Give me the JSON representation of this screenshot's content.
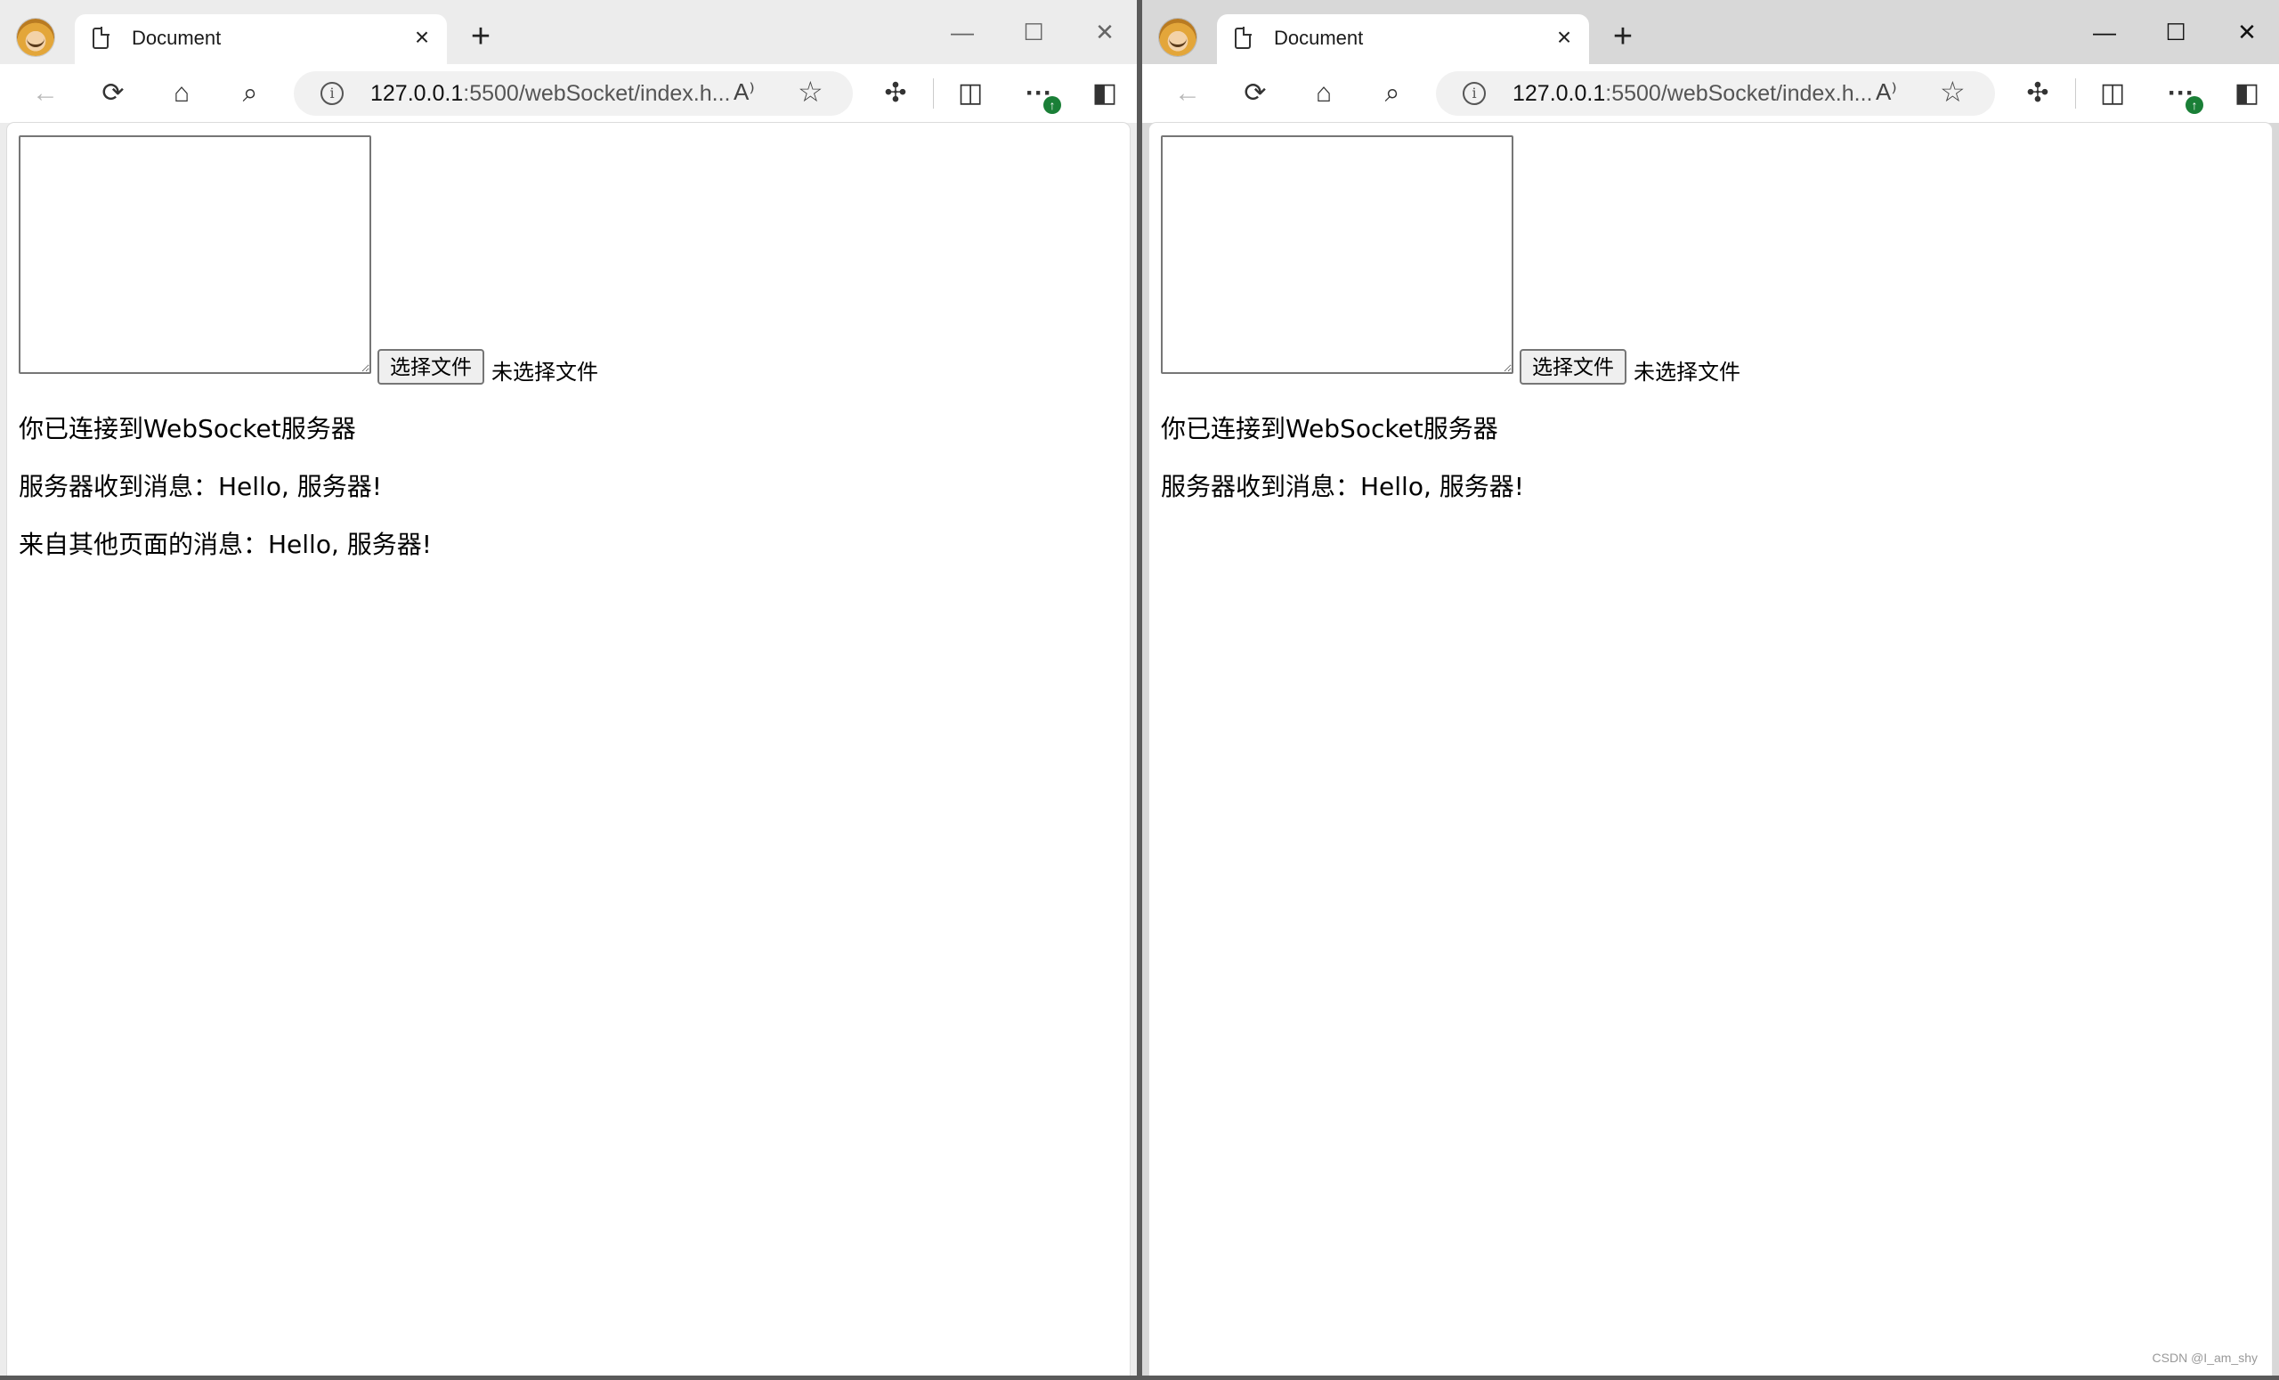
{
  "windows": [
    {
      "tab_title": "Document",
      "tab_close": "×",
      "new_tab": "+",
      "controls": {
        "minimize": "—",
        "maximize": "☐",
        "close": "✕"
      },
      "url_host": "127.0.0.1",
      "url_rest": ":5500/webSocket/index.h...",
      "file_button_label": "选择文件",
      "file_status": "未选择文件",
      "messages": [
        "你已连接到WebSocket服务器",
        "服务器收到消息：Hello, 服务器!",
        "来自其他页面的消息：Hello, 服务器!"
      ]
    },
    {
      "tab_title": "Document",
      "tab_close": "×",
      "new_tab": "+",
      "controls": {
        "minimize": "—",
        "maximize": "☐",
        "close": "✕"
      },
      "url_host": "127.0.0.1",
      "url_rest": ":5500/webSocket/index.h...",
      "file_button_label": "选择文件",
      "file_status": "未选择文件",
      "messages": [
        "你已连接到WebSocket服务器",
        "服务器收到消息：Hello, 服务器!"
      ]
    }
  ],
  "icons": {
    "back": "←",
    "reload": "⟳",
    "home": "⌂",
    "search": "⌕",
    "info": "i",
    "read_aloud": "A⁾",
    "favorite": "☆",
    "extensions": "✣",
    "split": "◫",
    "more": "···",
    "update_badge": "↑",
    "sidebar": "◧"
  },
  "watermark": "CSDN @I_am_shy"
}
